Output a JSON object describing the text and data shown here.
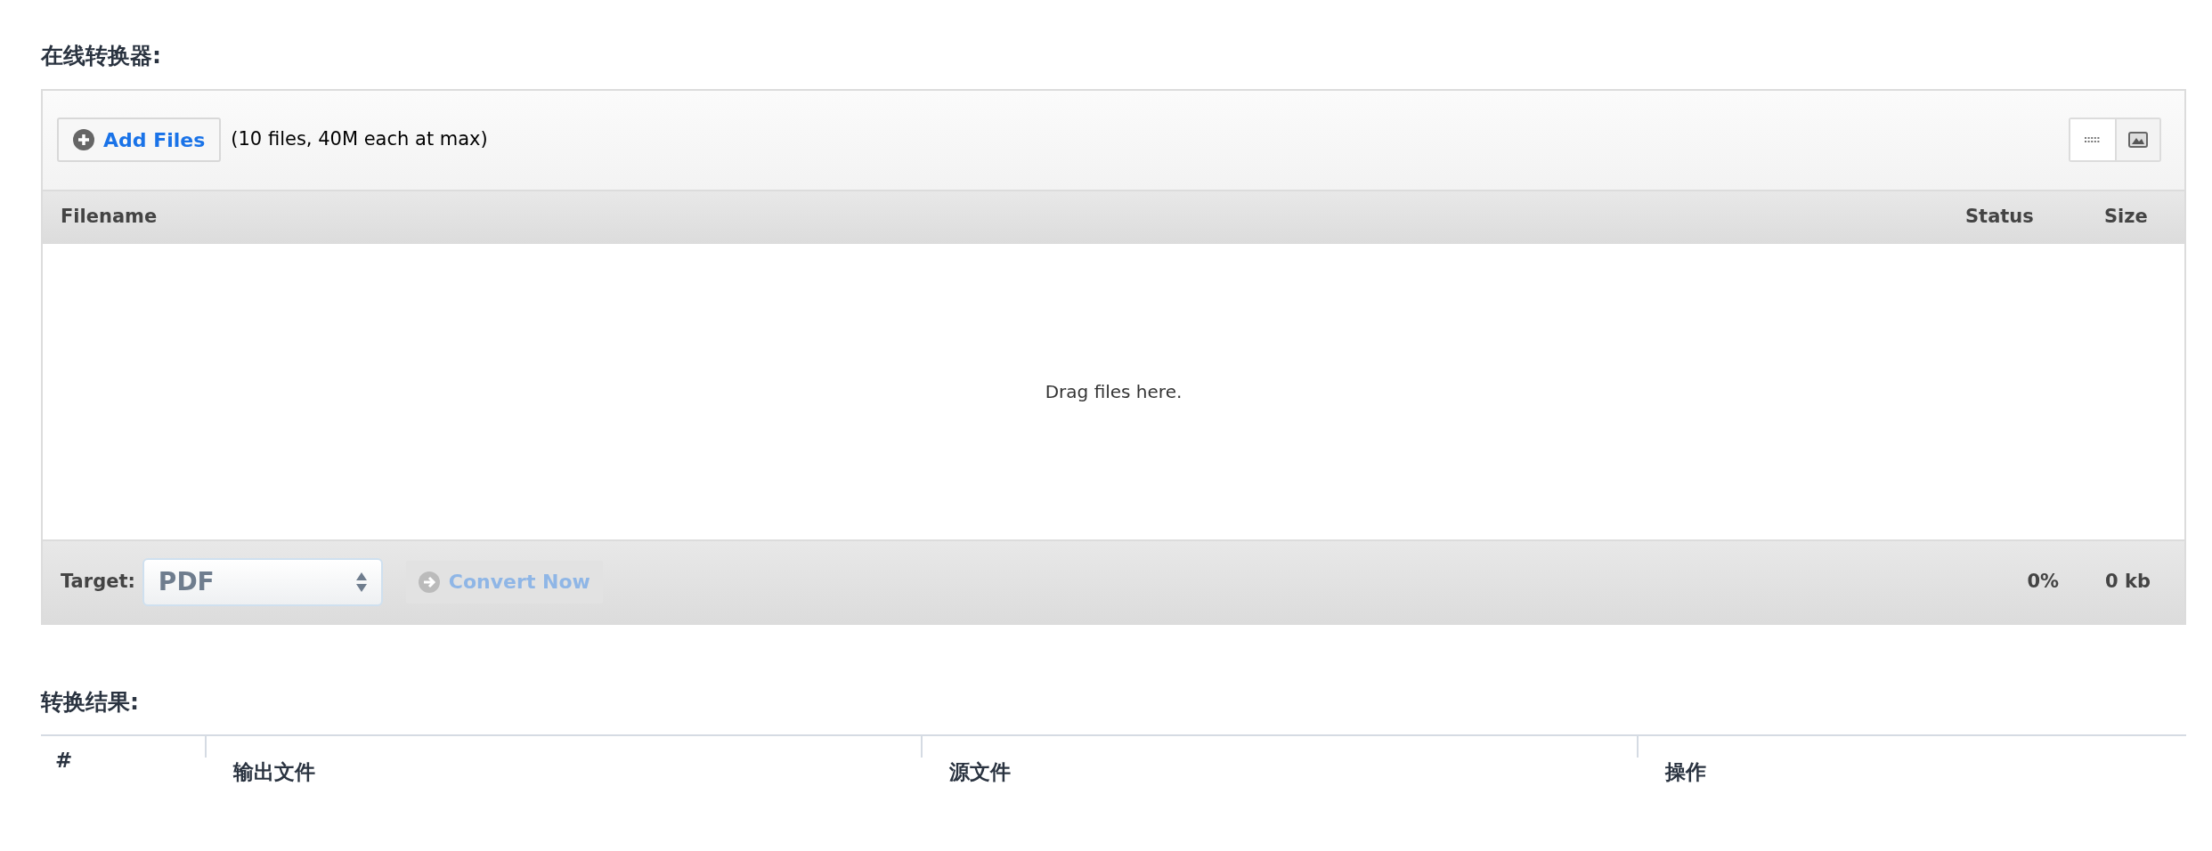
{
  "converter": {
    "heading": "在线转换器:",
    "add_button": {
      "label": "Add Files"
    },
    "limit_note": "(10 files, 40M each at max)",
    "view_toggles": [
      {
        "kind": "list",
        "selected": true
      },
      {
        "kind": "image",
        "selected": false
      }
    ],
    "file_table": {
      "columns": [
        "Filename",
        "Status",
        "Size"
      ],
      "empty_message": "Drag files here."
    },
    "footer": {
      "target_label": "Target:",
      "target_value": "PDF",
      "convert_button": {
        "label": "Convert Now",
        "disabled": true
      },
      "progress": "0%",
      "total_size": "0 kb"
    }
  },
  "results": {
    "heading": "转换结果:",
    "columns": [
      "#",
      "输出文件",
      "源文件",
      "操作"
    ]
  }
}
